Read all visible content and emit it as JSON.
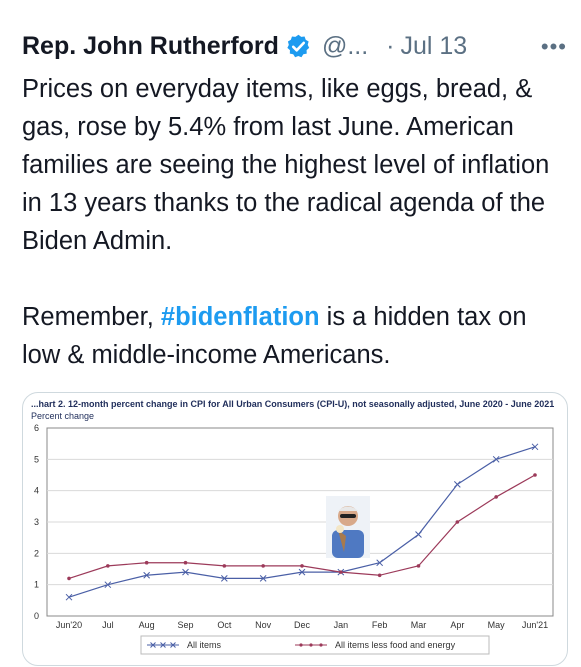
{
  "tweet": {
    "author_name": "Rep. John Rutherford",
    "handle": "@...",
    "separator": "·",
    "date": "Jul 13",
    "more_label": "•••",
    "paragraph1": "Prices on everyday items, like eggs, bread, & gas, rose by 5.4% from last June. American families are seeing the highest level of inflation in 13 years thanks to the radical agenda of the Biden Admin.",
    "paragraph2_before": "Remember, ",
    "hashtag": "#bidenflation",
    "paragraph2_after": " is a hidden tax on low & middle-income Americans.",
    "hashtag_color": "#1d9bf0",
    "verified_color": "#1d9bf0"
  },
  "chart_data": {
    "type": "line",
    "title": "...hart 2. 12-month percent change in CPI for All Urban Consumers (CPI-U), not seasonally adjusted, June 2020 - June 2021",
    "ylabel": "Percent change",
    "ylim": [
      0,
      6
    ],
    "yticks": [
      "0",
      "1",
      "2",
      "3",
      "4",
      "5",
      "6"
    ],
    "categories": [
      "Jun'20",
      "Jul",
      "Aug",
      "Sep",
      "Oct",
      "Nov",
      "Dec",
      "Jan",
      "Feb",
      "Mar",
      "Apr",
      "May",
      "Jun'21"
    ],
    "grid": true,
    "legend_position": "bottom",
    "series": [
      {
        "name": "All items",
        "color": "#4a5fa6",
        "marker": "x",
        "values": [
          0.6,
          1.0,
          1.3,
          1.4,
          1.2,
          1.2,
          1.4,
          1.4,
          1.7,
          2.6,
          4.2,
          5.0,
          5.4
        ]
      },
      {
        "name": "All items less food and energy",
        "color": "#9c3a5a",
        "marker": "dot",
        "values": [
          1.2,
          1.6,
          1.7,
          1.7,
          1.6,
          1.6,
          1.6,
          1.4,
          1.3,
          1.6,
          3.0,
          3.8,
          4.5
        ]
      }
    ]
  }
}
